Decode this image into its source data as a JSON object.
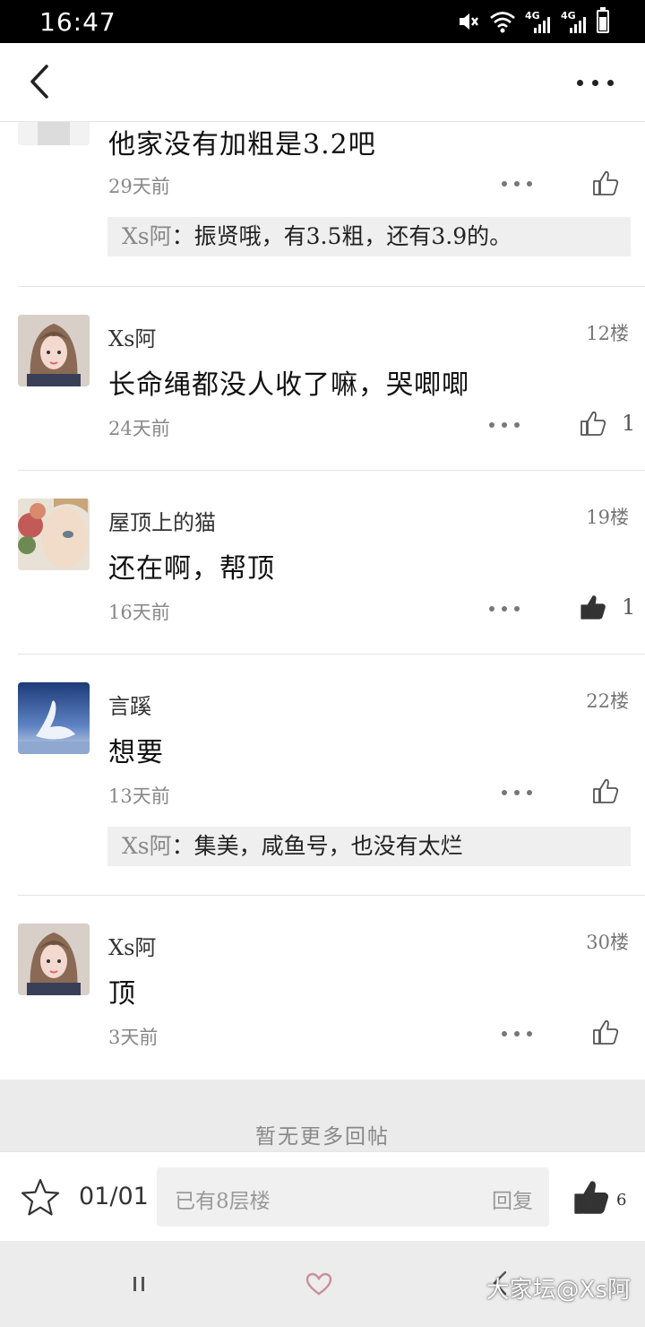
{
  "status_bar": {
    "time": "16:47",
    "network_label_1": "4G",
    "network_label_2": "4G"
  },
  "header": {
    "back_icon": "chevron-left-icon",
    "more_icon": "more-horizontal-icon"
  },
  "posts": [
    {
      "content": "他家没有加粗是3.2吧",
      "time": "29天前",
      "quote": {
        "name": "Xs阿",
        "text": "：振贤哦，有3.5粗，还有3.9的。"
      }
    },
    {
      "username": "Xs阿",
      "floor": "12楼",
      "content": "长命绳都没人收了嘛，哭唧唧",
      "time": "24天前",
      "likes": "1"
    },
    {
      "username": "屋顶上的猫",
      "floor": "19楼",
      "content": "还在啊，帮顶",
      "time": "16天前",
      "likes": "1"
    },
    {
      "username": "言蹊",
      "floor": "22楼",
      "content": "想要",
      "time": "13天前",
      "quote": {
        "name": "Xs阿",
        "text": "：集美，咸鱼号，也没有太烂"
      }
    },
    {
      "username": "Xs阿",
      "floor": "30楼",
      "content": "顶",
      "time": "3天前"
    }
  ],
  "no_more_text": "暂无更多回帖",
  "toolbar": {
    "page_indicator": "01/01",
    "reply_placeholder": "已有8层楼",
    "reply_label": "回复",
    "like_count": "6"
  },
  "watermark": "大家坛@Xs阿",
  "colors": {
    "accent_dark": "#333333",
    "like_filled": "#333333",
    "background_gray": "#ebebeb"
  }
}
